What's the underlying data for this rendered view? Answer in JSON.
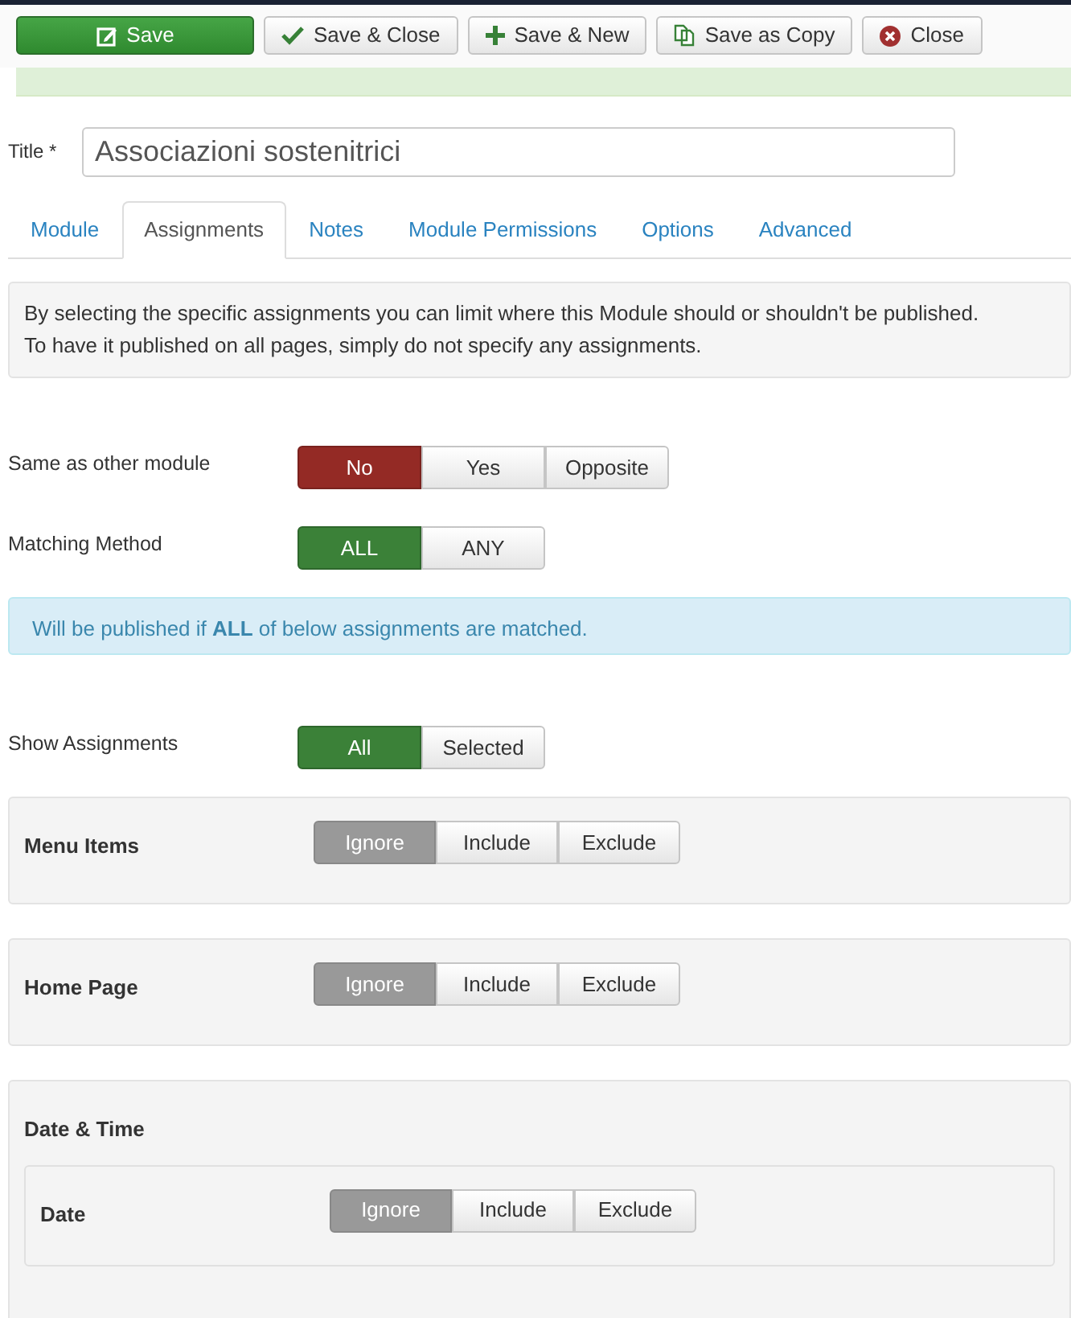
{
  "toolbar": [
    {
      "label": "Save",
      "kind": "primary"
    },
    {
      "label": "Save & Close",
      "kind": "default"
    },
    {
      "label": "Save & New",
      "kind": "default"
    },
    {
      "label": "Save as Copy",
      "kind": "default"
    },
    {
      "label": "Close",
      "kind": "default"
    }
  ],
  "title_field": {
    "label": "Title",
    "required_mark": "*",
    "value": "Associazioni sostenitrici"
  },
  "tabs": [
    {
      "label": "Module",
      "selected": false
    },
    {
      "label": "Assignments",
      "selected": true
    },
    {
      "label": "Notes",
      "selected": false
    },
    {
      "label": "Module Permissions",
      "selected": false
    },
    {
      "label": "Options",
      "selected": false
    },
    {
      "label": "Advanced",
      "selected": false
    }
  ],
  "intro": [
    "By selecting the specific assignments you can limit where this Module should or shouldn't be published.",
    "To have it published on all pages, simply do not specify any assignments."
  ],
  "settings": [
    {
      "label": "Same as other module",
      "kind": "danger",
      "options": [
        {
          "label": "No",
          "selected": true
        },
        {
          "label": "Yes",
          "selected": false
        },
        {
          "label": "Opposite",
          "selected": false
        }
      ]
    },
    {
      "label": "Matching Method",
      "kind": "success",
      "options": [
        {
          "label": "ALL",
          "selected": true
        },
        {
          "label": "ANY",
          "selected": false
        }
      ]
    }
  ],
  "info": "Will be published if **ALL** of below assignments are matched.",
  "show_assignments": {
    "label": "Show Assignments",
    "kind": "success",
    "options": [
      {
        "label": "All",
        "selected": true
      },
      {
        "label": "Selected",
        "selected": false
      }
    ]
  },
  "panels": [
    {
      "label": "Menu Items",
      "kind": "neutral",
      "options": [
        {
          "label": "Ignore",
          "selected": true
        },
        {
          "label": "Include",
          "selected": false
        },
        {
          "label": "Exclude",
          "selected": false
        }
      ]
    },
    {
      "label": "Home Page",
      "kind": "neutral",
      "options": [
        {
          "label": "Ignore",
          "selected": true
        },
        {
          "label": "Include",
          "selected": false
        },
        {
          "label": "Exclude",
          "selected": false
        }
      ]
    },
    {
      "label": "Date & Time",
      "children": [
        {
          "label": "Date",
          "kind": "neutral",
          "options": [
            {
              "label": "Ignore",
              "selected": true
            },
            {
              "label": "Include",
              "selected": false
            },
            {
              "label": "Exclude",
              "selected": false
            }
          ]
        }
      ]
    }
  ]
}
